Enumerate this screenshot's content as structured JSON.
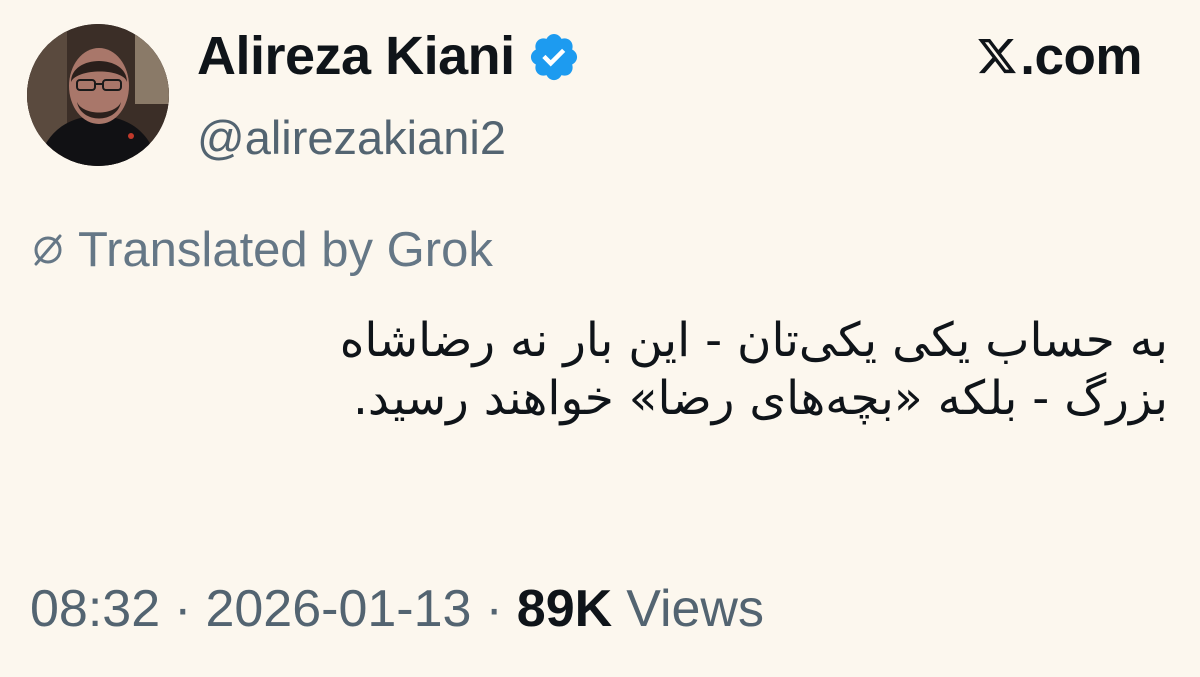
{
  "author": {
    "display_name": "Alireza Kiani",
    "handle": "@alirezakiani2",
    "verified": true,
    "verified_icon": "verified-badge-icon",
    "verified_color": "#1d9bf0"
  },
  "brand": {
    "label": ".com",
    "icon": "x-logo-icon"
  },
  "translation": {
    "label": "Translated by Grok",
    "icon": "grok-slash-icon"
  },
  "tweet": {
    "lines": [
      "به حساب یکی یکی‌تان - این بار نه رضاشاه",
      "بزرگ - بلکه «بچه‌های رضا» خواهند رسید."
    ]
  },
  "meta": {
    "time": "08:32",
    "separator": "·",
    "date": "2026-01-13",
    "views_count": "89K",
    "views_label": "Views"
  },
  "colors": {
    "background": "#fcf7ee",
    "text": "#0f1419",
    "secondary": "#536471"
  }
}
